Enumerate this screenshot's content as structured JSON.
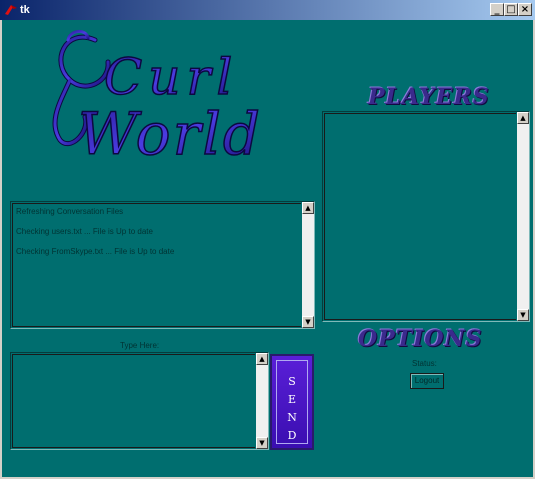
{
  "window": {
    "title": "tk",
    "icon": "tk-feather-icon",
    "controls": [
      "_",
      "□",
      "×"
    ]
  },
  "logo": {
    "line1": "Curl",
    "line2": "World"
  },
  "conversation": {
    "lines": [
      "Refreshing Conversation Files",
      "Checking users.txt ... File is Up to date",
      "Checking FromSkype.txt ... File is Up to date"
    ]
  },
  "players": {
    "heading": "PLAYERS"
  },
  "input": {
    "label": "Type Here:",
    "value": ""
  },
  "send": {
    "letters": [
      "S",
      "E",
      "N",
      "D"
    ]
  },
  "options": {
    "heading": "OPTIONS",
    "status_label": "Status:",
    "logout_label": "Logout"
  },
  "colors": {
    "background": "#006e6f",
    "send_button": "#4a16c8",
    "heading": "#3a2a8c"
  }
}
